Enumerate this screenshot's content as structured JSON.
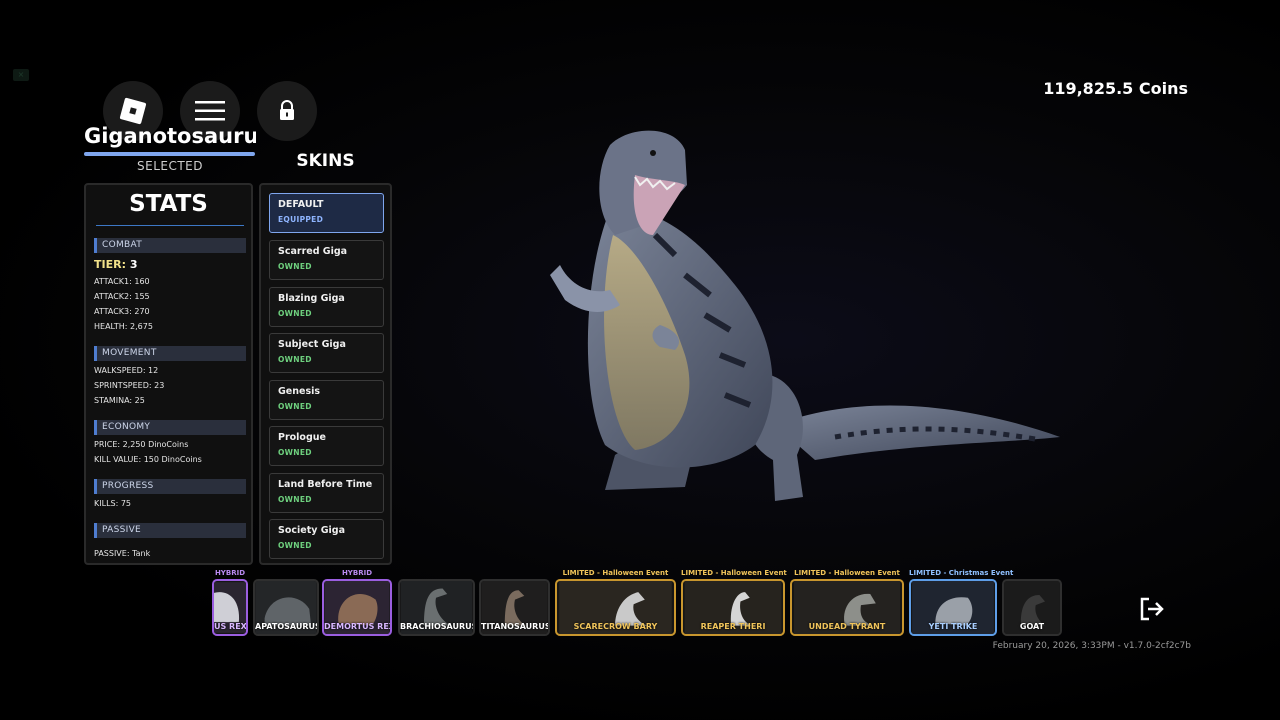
{
  "player": {
    "coins": "119,825.5 Coins"
  },
  "creature": {
    "name": "Giganotosaurus",
    "status": "SELECTED"
  },
  "stats": {
    "title": "STATS",
    "combat": {
      "header": "COMBAT",
      "tier_label": "TIER:",
      "tier_value": "3",
      "attack1": "ATTACK1: 160",
      "attack2": "ATTACK2: 155",
      "attack3": "ATTACK3: 270",
      "health": "HEALTH: 2,675"
    },
    "movement": {
      "header": "MOVEMENT",
      "walkspeed": "WALKSPEED: 12",
      "sprintspeed": "SPRINTSPEED: 23",
      "stamina": "STAMINA: 25"
    },
    "economy": {
      "header": "ECONOMY",
      "price": "PRICE: 2,250 DinoCoins",
      "kill_value": "KILL VALUE: 150 DinoCoins"
    },
    "progress": {
      "header": "PROGRESS",
      "kills": "KILLS: 75"
    },
    "passive": {
      "header": "PASSIVE",
      "value": "PASSIVE: Tank"
    }
  },
  "skins": {
    "title": "SKINS",
    "items": [
      {
        "name": "DEFAULT",
        "status": "EQUIPPED"
      },
      {
        "name": "Scarred Giga",
        "status": "OWNED"
      },
      {
        "name": "Blazing Giga",
        "status": "OWNED"
      },
      {
        "name": "Subject Giga",
        "status": "OWNED"
      },
      {
        "name": "Genesis",
        "status": "OWNED"
      },
      {
        "name": "Prologue",
        "status": "OWNED"
      },
      {
        "name": "Land Before Time",
        "status": "OWNED"
      },
      {
        "name": "Society Giga",
        "status": "OWNED"
      }
    ]
  },
  "carousel": {
    "items": [
      {
        "name": "US REX",
        "tag": "HYBRID",
        "kind": "hybrid"
      },
      {
        "name": "APATOSAURUS",
        "tag": "",
        "kind": "normal"
      },
      {
        "name": "DEMORTUS REX",
        "tag": "HYBRID",
        "kind": "hybrid"
      },
      {
        "name": "BRACHIOSAURUS",
        "tag": "",
        "kind": "normal"
      },
      {
        "name": "TITANOSAURUS",
        "tag": "",
        "kind": "normal"
      },
      {
        "name": "SCARECROW BARY",
        "tag": "LIMITED - Halloween Event",
        "kind": "halloween"
      },
      {
        "name": "REAPER THERI",
        "tag": "LIMITED - Halloween Event",
        "kind": "halloween"
      },
      {
        "name": "UNDEAD TYRANT",
        "tag": "LIMITED - Halloween Event",
        "kind": "halloween"
      },
      {
        "name": "YETI TRIKE",
        "tag": "LIMITED - Christmas Event",
        "kind": "christmas"
      },
      {
        "name": "GOAT",
        "tag": "",
        "kind": "normal"
      }
    ]
  },
  "footer": {
    "build": "February 20, 2026, 3:33PM - v1.7.0-2cf2c7b"
  },
  "icons": {
    "menu": "roblox-logo-icon",
    "hamburger": "hamburger-menu-icon",
    "lock": "lock-icon",
    "leave": "leave-game-icon"
  }
}
